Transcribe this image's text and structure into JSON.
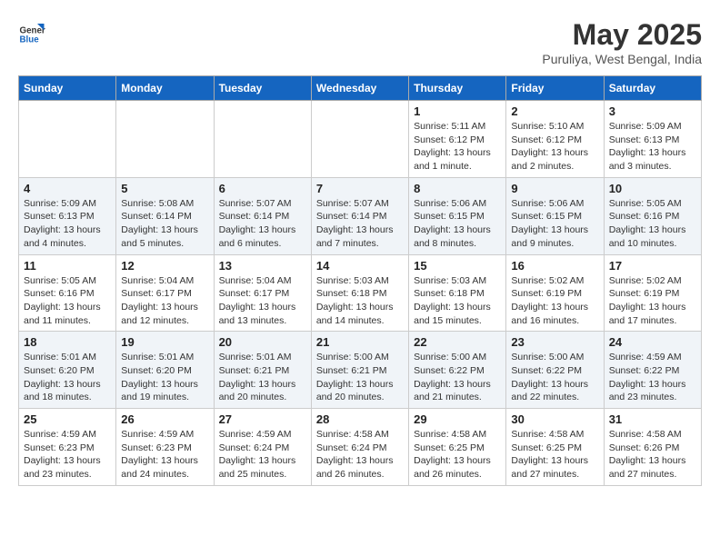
{
  "header": {
    "logo_line1": "General",
    "logo_line2": "Blue",
    "month_year": "May 2025",
    "location": "Puruliya, West Bengal, India"
  },
  "days_of_week": [
    "Sunday",
    "Monday",
    "Tuesday",
    "Wednesday",
    "Thursday",
    "Friday",
    "Saturday"
  ],
  "weeks": [
    [
      {
        "num": "",
        "info": ""
      },
      {
        "num": "",
        "info": ""
      },
      {
        "num": "",
        "info": ""
      },
      {
        "num": "",
        "info": ""
      },
      {
        "num": "1",
        "info": "Sunrise: 5:11 AM\nSunset: 6:12 PM\nDaylight: 13 hours and 1 minute."
      },
      {
        "num": "2",
        "info": "Sunrise: 5:10 AM\nSunset: 6:12 PM\nDaylight: 13 hours and 2 minutes."
      },
      {
        "num": "3",
        "info": "Sunrise: 5:09 AM\nSunset: 6:13 PM\nDaylight: 13 hours and 3 minutes."
      }
    ],
    [
      {
        "num": "4",
        "info": "Sunrise: 5:09 AM\nSunset: 6:13 PM\nDaylight: 13 hours and 4 minutes."
      },
      {
        "num": "5",
        "info": "Sunrise: 5:08 AM\nSunset: 6:14 PM\nDaylight: 13 hours and 5 minutes."
      },
      {
        "num": "6",
        "info": "Sunrise: 5:07 AM\nSunset: 6:14 PM\nDaylight: 13 hours and 6 minutes."
      },
      {
        "num": "7",
        "info": "Sunrise: 5:07 AM\nSunset: 6:14 PM\nDaylight: 13 hours and 7 minutes."
      },
      {
        "num": "8",
        "info": "Sunrise: 5:06 AM\nSunset: 6:15 PM\nDaylight: 13 hours and 8 minutes."
      },
      {
        "num": "9",
        "info": "Sunrise: 5:06 AM\nSunset: 6:15 PM\nDaylight: 13 hours and 9 minutes."
      },
      {
        "num": "10",
        "info": "Sunrise: 5:05 AM\nSunset: 6:16 PM\nDaylight: 13 hours and 10 minutes."
      }
    ],
    [
      {
        "num": "11",
        "info": "Sunrise: 5:05 AM\nSunset: 6:16 PM\nDaylight: 13 hours and 11 minutes."
      },
      {
        "num": "12",
        "info": "Sunrise: 5:04 AM\nSunset: 6:17 PM\nDaylight: 13 hours and 12 minutes."
      },
      {
        "num": "13",
        "info": "Sunrise: 5:04 AM\nSunset: 6:17 PM\nDaylight: 13 hours and 13 minutes."
      },
      {
        "num": "14",
        "info": "Sunrise: 5:03 AM\nSunset: 6:18 PM\nDaylight: 13 hours and 14 minutes."
      },
      {
        "num": "15",
        "info": "Sunrise: 5:03 AM\nSunset: 6:18 PM\nDaylight: 13 hours and 15 minutes."
      },
      {
        "num": "16",
        "info": "Sunrise: 5:02 AM\nSunset: 6:19 PM\nDaylight: 13 hours and 16 minutes."
      },
      {
        "num": "17",
        "info": "Sunrise: 5:02 AM\nSunset: 6:19 PM\nDaylight: 13 hours and 17 minutes."
      }
    ],
    [
      {
        "num": "18",
        "info": "Sunrise: 5:01 AM\nSunset: 6:20 PM\nDaylight: 13 hours and 18 minutes."
      },
      {
        "num": "19",
        "info": "Sunrise: 5:01 AM\nSunset: 6:20 PM\nDaylight: 13 hours and 19 minutes."
      },
      {
        "num": "20",
        "info": "Sunrise: 5:01 AM\nSunset: 6:21 PM\nDaylight: 13 hours and 20 minutes."
      },
      {
        "num": "21",
        "info": "Sunrise: 5:00 AM\nSunset: 6:21 PM\nDaylight: 13 hours and 20 minutes."
      },
      {
        "num": "22",
        "info": "Sunrise: 5:00 AM\nSunset: 6:22 PM\nDaylight: 13 hours and 21 minutes."
      },
      {
        "num": "23",
        "info": "Sunrise: 5:00 AM\nSunset: 6:22 PM\nDaylight: 13 hours and 22 minutes."
      },
      {
        "num": "24",
        "info": "Sunrise: 4:59 AM\nSunset: 6:22 PM\nDaylight: 13 hours and 23 minutes."
      }
    ],
    [
      {
        "num": "25",
        "info": "Sunrise: 4:59 AM\nSunset: 6:23 PM\nDaylight: 13 hours and 23 minutes."
      },
      {
        "num": "26",
        "info": "Sunrise: 4:59 AM\nSunset: 6:23 PM\nDaylight: 13 hours and 24 minutes."
      },
      {
        "num": "27",
        "info": "Sunrise: 4:59 AM\nSunset: 6:24 PM\nDaylight: 13 hours and 25 minutes."
      },
      {
        "num": "28",
        "info": "Sunrise: 4:58 AM\nSunset: 6:24 PM\nDaylight: 13 hours and 26 minutes."
      },
      {
        "num": "29",
        "info": "Sunrise: 4:58 AM\nSunset: 6:25 PM\nDaylight: 13 hours and 26 minutes."
      },
      {
        "num": "30",
        "info": "Sunrise: 4:58 AM\nSunset: 6:25 PM\nDaylight: 13 hours and 27 minutes."
      },
      {
        "num": "31",
        "info": "Sunrise: 4:58 AM\nSunset: 6:26 PM\nDaylight: 13 hours and 27 minutes."
      }
    ]
  ]
}
